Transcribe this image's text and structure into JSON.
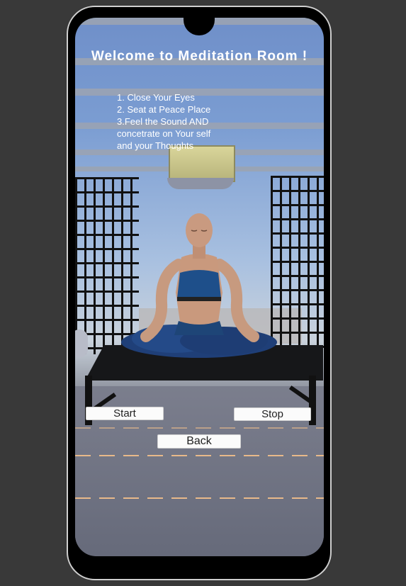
{
  "screen": {
    "title": "Welcome to Meditation Room !",
    "instructions": [
      "1. Close Your Eyes",
      "2. Seat at Peace Place",
      "3.Feel the Sound AND",
      "concetrate on Your self",
      "and your Thoughts"
    ]
  },
  "buttons": {
    "start": "Start",
    "stop": "Stop",
    "back": "Back"
  },
  "colors": {
    "button_bg": "#fbfbfb",
    "button_text": "#1f1f1f",
    "title_text": "#ffffff"
  }
}
